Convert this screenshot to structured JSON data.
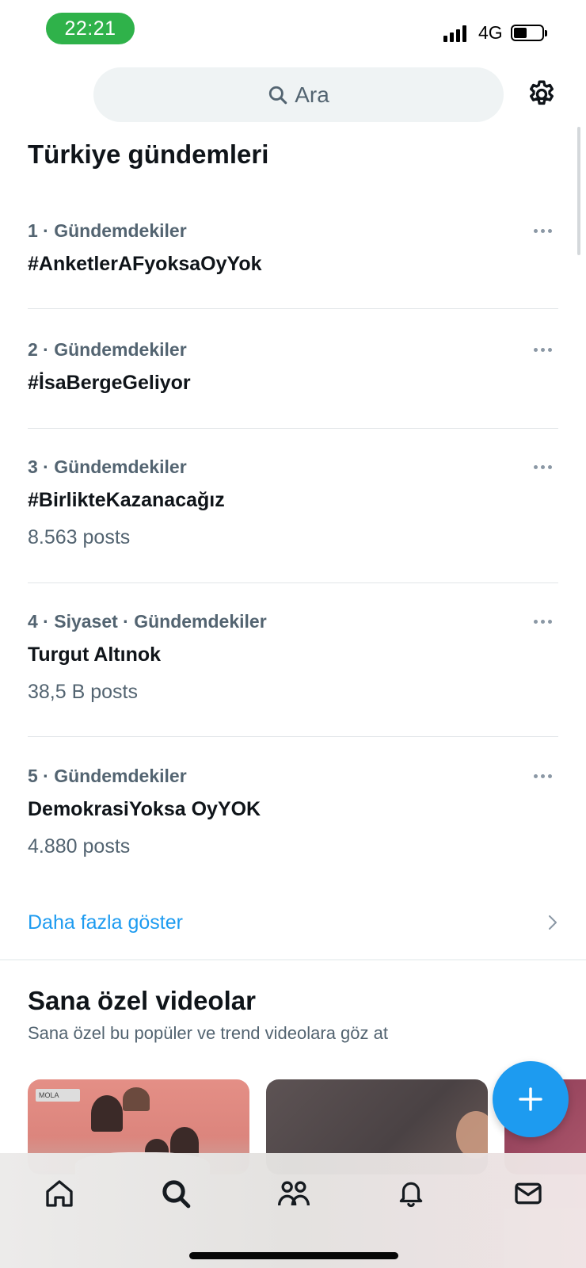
{
  "status_bar": {
    "time": "22:21",
    "network": "4G",
    "battery_level": 0.45
  },
  "search": {
    "placeholder": "Ara"
  },
  "section_title": "Türkiye gündemleri",
  "trends": [
    {
      "meta": "1 · Gündemdekiler",
      "name": "#AnketlerAFyoksaOyYok",
      "posts": ""
    },
    {
      "meta": "2 · Gündemdekiler",
      "name": "#İsaBergeGeliyor",
      "posts": ""
    },
    {
      "meta": "3 · Gündemdekiler",
      "name": "#BirlikteKazanacağız",
      "posts": "8.563 posts"
    },
    {
      "meta": "4 · Siyaset · Gündemdekiler",
      "name": "Turgut Altınok",
      "posts": "38,5 B posts"
    },
    {
      "meta": "5 · Gündemdekiler",
      "name": "DemokrasiYoksa OyYOK",
      "posts": "4.880 posts"
    }
  ],
  "show_more": "Daha fazla göster",
  "videos": {
    "title": "Sana özel videolar",
    "subtitle": "Sana özel bu popüler ve trend videolara göz at",
    "thumb1_tag": "MOLA"
  },
  "bottom_nav": [
    "home-icon",
    "search-icon",
    "communities-icon",
    "notifications-icon",
    "messages-icon"
  ],
  "colors": {
    "accent": "#1d9bf0",
    "time_pill": "#2fb24a",
    "secondary_text": "#536471"
  }
}
